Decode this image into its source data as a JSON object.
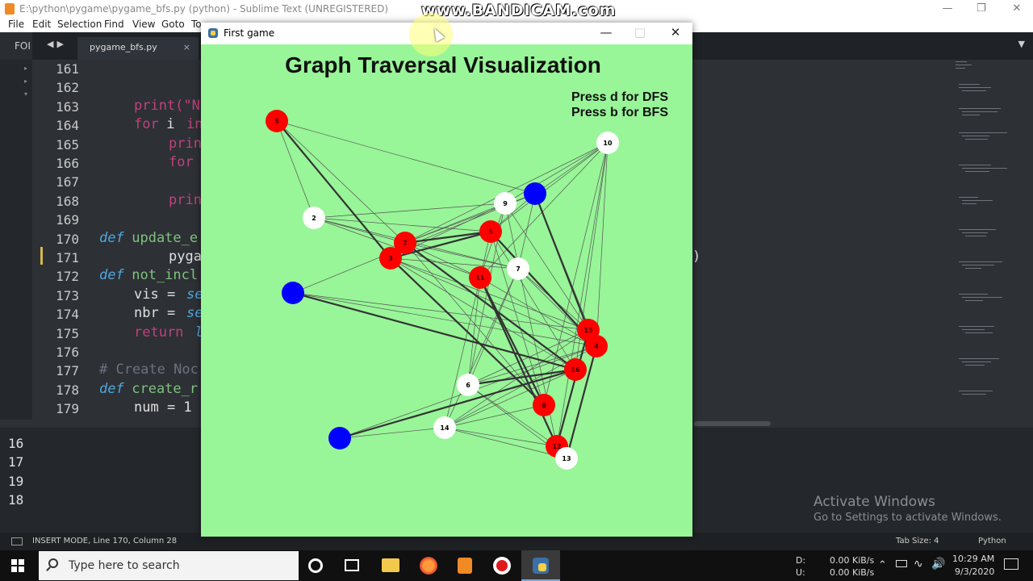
{
  "sublime": {
    "title": "E:\\python\\pygame\\pygame_bfs.py (python) - Sublime Text (UNREGISTERED)",
    "menu": [
      "File",
      "Edit",
      "Selection",
      "Find",
      "View",
      "Goto",
      "To"
    ],
    "sidebar_label": "FOI",
    "tab_name": "pygame_bfs.py",
    "tab_close": "×",
    "line_numbers": [
      "161",
      "162",
      "163",
      "164",
      "165",
      "166",
      "167",
      "168",
      "169",
      "170",
      "171",
      "172",
      "173",
      "174",
      "175",
      "176",
      "177",
      "178",
      "179"
    ],
    "code": {
      "l163": "print(\"N",
      "l164_kw": "for",
      "l164_rest": " i ",
      "l164_in": "in",
      "l165": "prin",
      "l166": "for",
      "l168": "prin",
      "l170_def": "def",
      "l170_fn": " update_e",
      "l171": "pyga",
      "l172_def": "def",
      "l172_fn": " not_incl",
      "l173_a": "vis = ",
      "l173_b": "se",
      "l174_a": "nbr = ",
      "l174_b": "se",
      "l175_kw": "return",
      "l175_b": " l",
      "l177": "# Create Noc",
      "l178_def": "def",
      "l178_fn": " create_r",
      "l179": "num = 1",
      "right_paren": ")"
    },
    "console_lines": [
      "16",
      "17",
      "19",
      "18"
    ],
    "status_left": "INSERT MODE, Line 170, Column 28",
    "tab_size": "Tab Size: 4",
    "syntax": "Python",
    "activate_title": "Activate Windows",
    "activate_sub": "Go to Settings to activate Windows."
  },
  "watermark": "www.BANDICAM.com",
  "pygame": {
    "window_title": "First game",
    "heading": "Graph Traversal Visualization",
    "hint_dfs": "Press d for DFS",
    "hint_bfs": "Press b for BFS",
    "colors": {
      "background": "#98f598",
      "visited": "#ff0000",
      "unvisited": "#ffffff",
      "current": "#0000ff"
    },
    "nodes": [
      {
        "label": "5",
        "state": "visited"
      },
      {
        "label": "2",
        "state": "unvisited"
      },
      {
        "label": "10",
        "state": "unvisited"
      },
      {
        "label": "9",
        "state": "unvisited"
      },
      {
        "label": "",
        "state": "current"
      },
      {
        "label": "7",
        "state": "visited"
      },
      {
        "label": "3",
        "state": "visited"
      },
      {
        "label": "5",
        "state": "visited"
      },
      {
        "label": "7",
        "state": "unvisited"
      },
      {
        "label": "11",
        "state": "visited"
      },
      {
        "label": "",
        "state": "current"
      },
      {
        "label": "15",
        "state": "visited"
      },
      {
        "label": "4",
        "state": "visited"
      },
      {
        "label": "16",
        "state": "visited"
      },
      {
        "label": "6",
        "state": "unvisited"
      },
      {
        "label": "8",
        "state": "visited"
      },
      {
        "label": "14",
        "state": "unvisited"
      },
      {
        "label": "",
        "state": "current"
      },
      {
        "label": "12",
        "state": "visited"
      },
      {
        "label": "13",
        "state": "unvisited"
      }
    ]
  },
  "taskbar": {
    "search_placeholder": "Type here to search",
    "net_d_label": "D:",
    "net_u_label": "U:",
    "net_d": "0.00 KiB/s",
    "net_u": "0.00 KiB/s",
    "time": "10:29 AM",
    "date": "9/3/2020"
  }
}
